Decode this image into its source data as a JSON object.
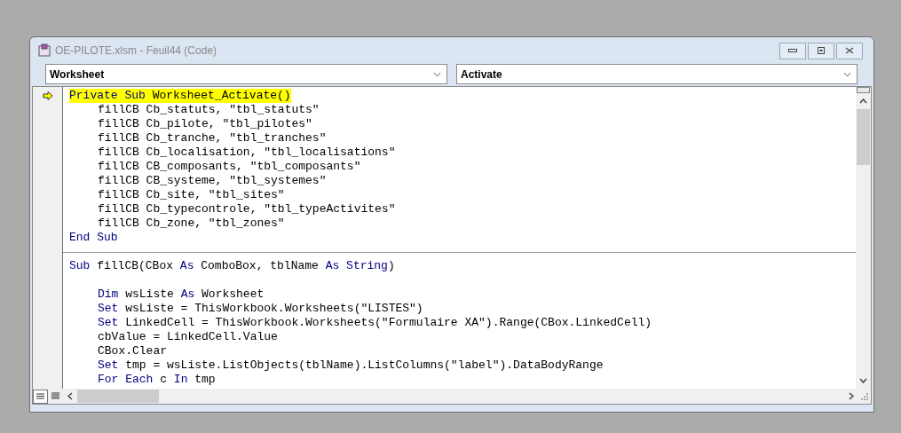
{
  "window": {
    "title": "OE-PILOTE.xlsm - Feuil44 (Code)"
  },
  "object_dropdown": {
    "value": "Worksheet"
  },
  "procedure_dropdown": {
    "value": "Activate"
  },
  "procedures": [
    {
      "lines": [
        {
          "tokens": [
            {
              "text": "Private Sub",
              "keyword": true
            },
            {
              "text": " Worksheet_Activate()",
              "keyword": false
            }
          ],
          "indented": false,
          "highlighted": true,
          "execution_point": true,
          "space_before": false
        },
        {
          "tokens": [
            {
              "text": "fillCB Cb_statuts, \"tbl_statuts\"",
              "keyword": false
            }
          ],
          "indented": true,
          "highlighted": false,
          "execution_point": false,
          "space_before": false
        },
        {
          "tokens": [
            {
              "text": "fillCB Cb_pilote, \"tbl_pilotes\"",
              "keyword": false
            }
          ],
          "indented": true,
          "highlighted": false,
          "execution_point": false,
          "space_before": false
        },
        {
          "tokens": [
            {
              "text": "fillCB Cb_tranche, \"tbl_tranches\"",
              "keyword": false
            }
          ],
          "indented": true,
          "highlighted": false,
          "execution_point": false,
          "space_before": false
        },
        {
          "tokens": [
            {
              "text": "fillCB Cb_localisation, \"tbl_localisations\"",
              "keyword": false
            }
          ],
          "indented": true,
          "highlighted": false,
          "execution_point": false,
          "space_before": false
        },
        {
          "tokens": [
            {
              "text": "fillCB CB_composants, \"tbl_composants\"",
              "keyword": false
            }
          ],
          "indented": true,
          "highlighted": false,
          "execution_point": false,
          "space_before": false
        },
        {
          "tokens": [
            {
              "text": "fillCB CB_systeme, \"tbl_systemes\"",
              "keyword": false
            }
          ],
          "indented": true,
          "highlighted": false,
          "execution_point": false,
          "space_before": false
        },
        {
          "tokens": [
            {
              "text": "fillCB Cb_site, \"tbl_sites\"",
              "keyword": false
            }
          ],
          "indented": true,
          "highlighted": false,
          "execution_point": false,
          "space_before": false
        },
        {
          "tokens": [
            {
              "text": "fillCB Cb_typecontrole, \"tbl_typeActivites\"",
              "keyword": false
            }
          ],
          "indented": true,
          "highlighted": false,
          "execution_point": false,
          "space_before": false
        },
        {
          "tokens": [
            {
              "text": "fillCB Cb_zone, \"tbl_zones\"",
              "keyword": false
            }
          ],
          "indented": true,
          "highlighted": false,
          "execution_point": false,
          "space_before": false
        },
        {
          "tokens": [
            {
              "text": "End Sub",
              "keyword": true
            }
          ],
          "indented": false,
          "highlighted": false,
          "execution_point": false,
          "space_before": false
        }
      ]
    },
    {
      "lines": [
        {
          "tokens": [
            {
              "text": "Sub",
              "keyword": true
            },
            {
              "text": " fillCB(CBox ",
              "keyword": false
            },
            {
              "text": "As",
              "keyword": true
            },
            {
              "text": " ComboBox, tblName ",
              "keyword": false
            },
            {
              "text": "As String",
              "keyword": true
            },
            {
              "text": ")",
              "keyword": false
            }
          ],
          "indented": false,
          "highlighted": false,
          "execution_point": false,
          "space_before": true
        },
        {
          "tokens": [
            {
              "text": "Dim",
              "keyword": true
            },
            {
              "text": " wsListe ",
              "keyword": false
            },
            {
              "text": "As",
              "keyword": true
            },
            {
              "text": " Worksheet",
              "keyword": false
            }
          ],
          "indented": true,
          "highlighted": false,
          "execution_point": false,
          "space_before": true
        },
        {
          "tokens": [
            {
              "text": "Set",
              "keyword": true
            },
            {
              "text": " wsListe = ThisWorkbook.Worksheets(\"LISTES\")",
              "keyword": false
            }
          ],
          "indented": true,
          "highlighted": false,
          "execution_point": false,
          "space_before": false
        },
        {
          "tokens": [
            {
              "text": "Set",
              "keyword": true
            },
            {
              "text": " LinkedCell = ThisWorkbook.Worksheets(\"Formulaire XA\").Range(CBox.LinkedCell)",
              "keyword": false
            }
          ],
          "indented": true,
          "highlighted": false,
          "execution_point": false,
          "space_before": false
        },
        {
          "tokens": [
            {
              "text": "cbValue = LinkedCell.Value",
              "keyword": false
            }
          ],
          "indented": true,
          "highlighted": false,
          "execution_point": false,
          "space_before": false
        },
        {
          "tokens": [
            {
              "text": "CBox.Clear",
              "keyword": false
            }
          ],
          "indented": true,
          "highlighted": false,
          "execution_point": false,
          "space_before": false
        },
        {
          "tokens": [
            {
              "text": "Set",
              "keyword": true
            },
            {
              "text": " tmp = wsListe.ListObjects(tblName).ListColumns(\"label\").DataBodyRange",
              "keyword": false
            }
          ],
          "indented": true,
          "highlighted": false,
          "execution_point": false,
          "space_before": false
        },
        {
          "tokens": [
            {
              "text": "For Each",
              "keyword": true
            },
            {
              "text": " c ",
              "keyword": false
            },
            {
              "text": "In",
              "keyword": true
            },
            {
              "text": " tmp",
              "keyword": false
            }
          ],
          "indented": true,
          "highlighted": false,
          "execution_point": false,
          "space_before": false
        }
      ]
    }
  ]
}
